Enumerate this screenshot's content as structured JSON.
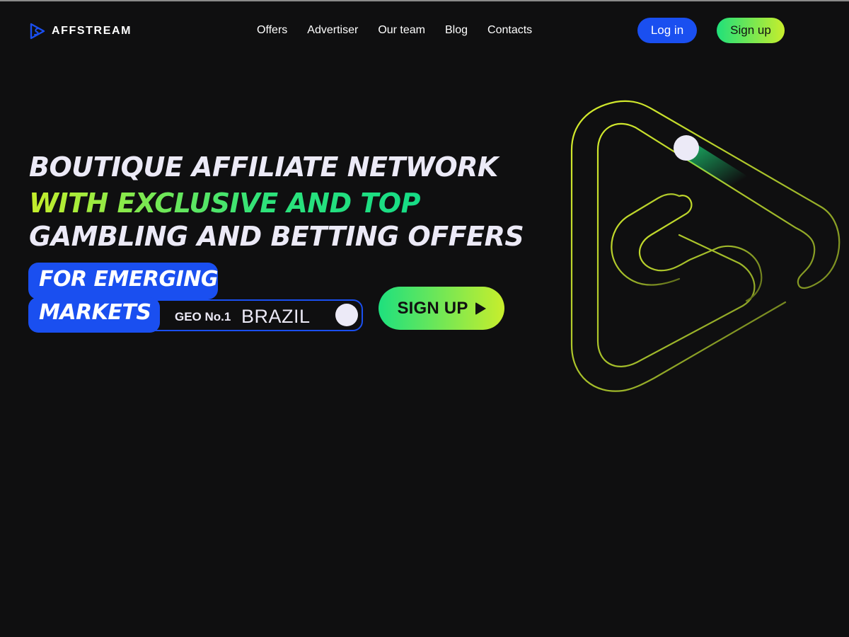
{
  "header": {
    "brand": "AFFSTREAM",
    "nav": [
      "Offers",
      "Advertiser",
      "Our team",
      "Blog",
      "Contacts"
    ],
    "login_label": "Log in",
    "signup_label": "Sign up"
  },
  "hero": {
    "line1": "BOUTIQUE AFFILIATE NETWORK",
    "line2": "WITH EXCLUSIVE AND TOP",
    "line3": "GAMBLING AND BETTING OFFERS",
    "pill1": "FOR EMERGING",
    "pill2": "MARKETS",
    "geo_label": "GEO No.1",
    "geo_country": "BRAZIL",
    "cta_label": "SIGN UP"
  },
  "colors": {
    "background": "#0f0f10",
    "accent_blue": "#1a4ff0",
    "accent_green": "#20e07a",
    "accent_lime": "#c8ee2c",
    "text": "#eceaf7"
  },
  "icons": {
    "logo": "affstream-logo-icon",
    "cta": "play-icon"
  }
}
